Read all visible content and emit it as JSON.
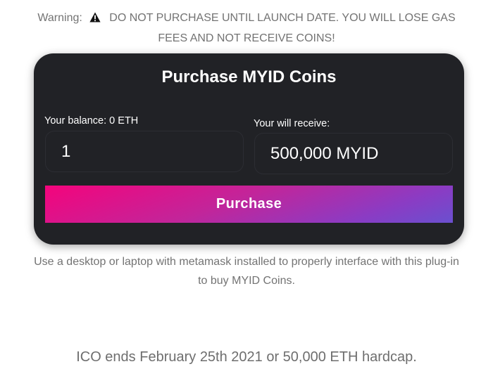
{
  "warning": {
    "prefix": "Warning:",
    "icon": "warning-triangle-icon",
    "message": "DO NOT PURCHASE UNTIL LAUNCH DATE. YOU WILL LOSE GAS FEES AND NOT RECEIVE COINS!"
  },
  "card": {
    "title": "Purchase MYID Coins",
    "balance_label": "Your balance: 0 ETH",
    "amount_value": "1",
    "receive_label": "Your will receive:",
    "receive_value": "500,000 MYID",
    "button_label": "Purchase"
  },
  "note": "Use a desktop or laptop with metamask installed to properly interface with this plug-in to buy MYID Coins.",
  "ico_text": "ICO ends February 25th 2021 or 50,000 ETH hardcap.",
  "colors": {
    "card_bg": "#212226",
    "gradient_start": "#f4047c",
    "gradient_end": "#6a50cf"
  }
}
